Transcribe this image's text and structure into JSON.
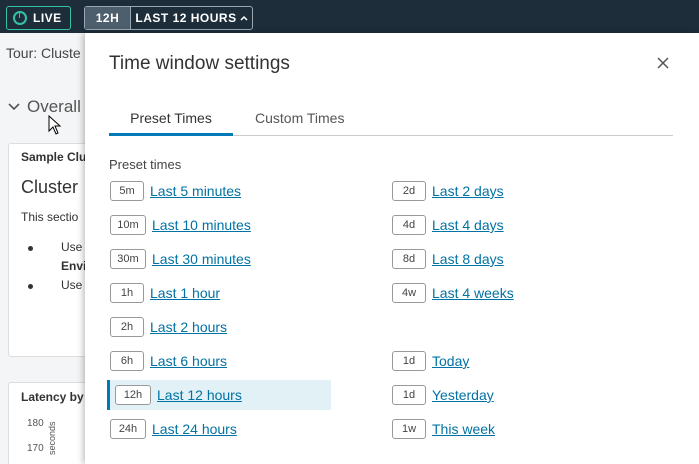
{
  "topbar": {
    "live_label": "LIVE",
    "time_abbr": "12H",
    "time_label": "LAST 12 HOURS",
    "chevron_icon": "chevron-up-icon"
  },
  "background": {
    "tour_text": "Tour: Cluste",
    "overall_label": "Overall",
    "card1": {
      "title": "Sample Clu",
      "heading": "Cluster",
      "text": "This sectio",
      "bullet1": "Use",
      "bullet1_bold": "Envi",
      "bullet2": "Use"
    },
    "card2": {
      "title": "Latency by",
      "ticks": [
        "180",
        "170"
      ],
      "yunit": "seconds"
    }
  },
  "modal": {
    "title": "Time window settings",
    "close_icon": "close-icon",
    "tabs": [
      {
        "label": "Preset Times",
        "active": true
      },
      {
        "label": "Custom Times",
        "active": false
      }
    ],
    "section_label": "Preset times",
    "left_options": [
      {
        "abbr": "5m",
        "label": "Last 5 minutes",
        "selected": false
      },
      {
        "abbr": "10m",
        "label": "Last 10 minutes",
        "selected": false
      },
      {
        "abbr": "30m",
        "label": "Last 30 minutes",
        "selected": false
      },
      {
        "abbr": "1h",
        "label": "Last 1 hour",
        "selected": false
      },
      {
        "abbr": "2h",
        "label": "Last 2 hours",
        "selected": false
      },
      {
        "abbr": "6h",
        "label": "Last 6 hours",
        "selected": false
      },
      {
        "abbr": "12h",
        "label": "Last 12 hours",
        "selected": true
      },
      {
        "abbr": "24h",
        "label": "Last 24 hours",
        "selected": false
      }
    ],
    "right_options": [
      {
        "abbr": "2d",
        "label": "Last 2 days"
      },
      {
        "abbr": "4d",
        "label": "Last 4 days"
      },
      {
        "abbr": "8d",
        "label": "Last 8 days"
      },
      {
        "abbr": "4w",
        "label": "Last 4 weeks"
      },
      {
        "abbr": "1d",
        "label": "Today"
      },
      {
        "abbr": "1d",
        "label": "Yesterday"
      },
      {
        "abbr": "1w",
        "label": "This week"
      }
    ]
  },
  "colors": {
    "topbar_bg": "#1d2d3a",
    "live_accent": "#34c1a8",
    "link": "#0072a3",
    "active_tab": "#0079b8",
    "selected_bg": "#e1f1f6"
  }
}
